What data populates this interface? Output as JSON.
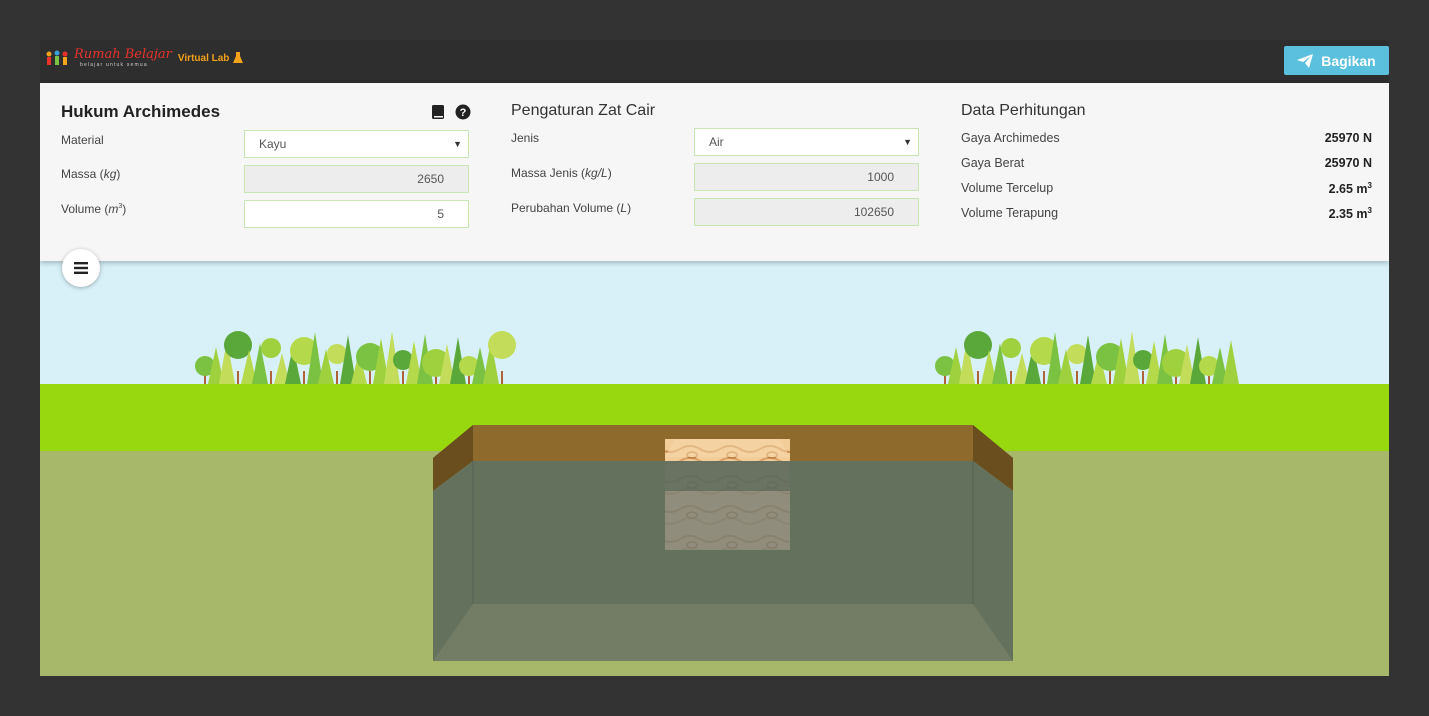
{
  "topbar": {
    "brand": "Rumah Belajar",
    "tagline": "belajar untuk semua",
    "lab": "Virtual Lab",
    "share_label": "Bagikan"
  },
  "panel1": {
    "title": "Hukum Archimedes",
    "material_label": "Material",
    "material_value": "Kayu",
    "massa_label": "Massa (",
    "massa_unit": "kg",
    "massa_value": "2650",
    "volume_label": "Volume (",
    "volume_unit": "m",
    "volume_value": "5"
  },
  "panel2": {
    "title": "Pengaturan Zat Cair",
    "jenis_label": "Jenis",
    "jenis_value": "Air",
    "massa_jenis_label": "Massa Jenis (",
    "massa_jenis_unit": "kg/L",
    "massa_jenis_value": "1000",
    "perubahan_label": "Perubahan Volume (",
    "perubahan_unit": "L",
    "perubahan_value": "102650"
  },
  "panel3": {
    "title": "Data Perhitungan",
    "rows": [
      {
        "label": "Gaya Archimedes",
        "value": "25970 N"
      },
      {
        "label": "Gaya Berat",
        "value": "25970 N"
      },
      {
        "label": "Volume Tercelup",
        "value": "2.65 m"
      },
      {
        "label": "Volume Terapung",
        "value": "2.35 m"
      }
    ],
    "sup": "3"
  },
  "icons": {
    "book": "book-icon",
    "help": "question-circle-icon",
    "menu": "hamburger-menu-icon",
    "share": "paper-plane-icon"
  },
  "colors": {
    "sky": "#d8f1f8",
    "grass": "#97d80e",
    "ground": "#a7b86a",
    "water": "#5f6c5d",
    "share": "#5bc0de",
    "wood": "#f0c48a"
  },
  "simulation": {
    "submerged_fraction": 0.53
  }
}
